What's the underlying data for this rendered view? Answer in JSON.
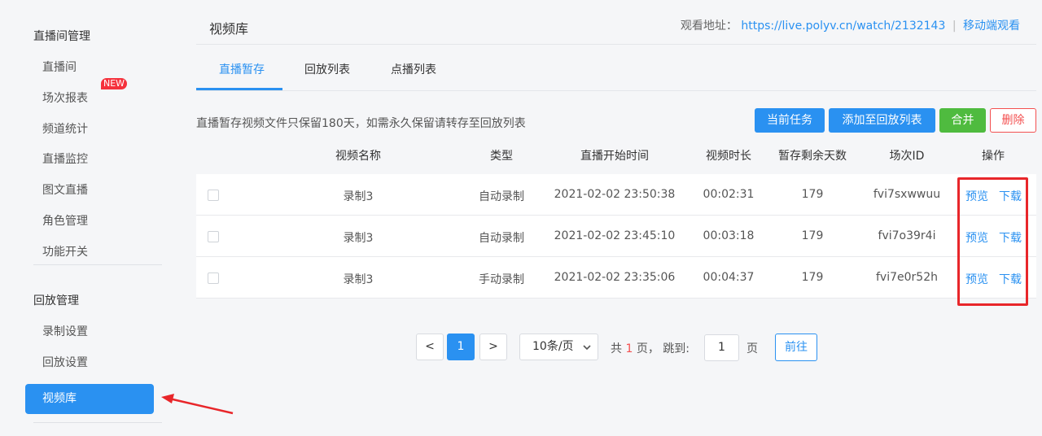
{
  "sidebar": {
    "group1_title": "直播间管理",
    "group1_items": [
      "直播间",
      "场次报表",
      "频道统计",
      "直播监控",
      "图文直播",
      "角色管理",
      "功能开关"
    ],
    "new_badge": "NEW",
    "group2_title": "回放管理",
    "group2_items": [
      "录制设置",
      "回放设置"
    ],
    "active_item": "视频库"
  },
  "header": {
    "title": "视频库",
    "watch_label": "观看地址：",
    "watch_url": "https://live.polyv.cn/watch/2132143",
    "separator": "|",
    "mobile_link": "移动端观看"
  },
  "tabs": [
    "直播暂存",
    "回放列表",
    "点播列表"
  ],
  "notice": "直播暂存视频文件只保留180天，如需永久保留请转存至回放列表",
  "toolbar": {
    "current_task": "当前任务",
    "add_to_playback": "添加至回放列表",
    "merge": "合并",
    "delete": "删除"
  },
  "table": {
    "columns": [
      "视频名称",
      "类型",
      "直播开始时间",
      "视频时长",
      "暂存剩余天数",
      "场次ID",
      "操作"
    ],
    "rows": [
      {
        "name": "录制3",
        "type": "自动录制",
        "start": "2021-02-02 23:50:38",
        "duration": "00:02:31",
        "days": "179",
        "session": "fvi7sxwwuu"
      },
      {
        "name": "录制3",
        "type": "自动录制",
        "start": "2021-02-02 23:45:10",
        "duration": "00:03:18",
        "days": "179",
        "session": "fvi7o39r4i"
      },
      {
        "name": "录制3",
        "type": "手动录制",
        "start": "2021-02-02 23:35:06",
        "duration": "00:04:37",
        "days": "179",
        "session": "fvi7e0r52h"
      }
    ],
    "action_preview": "预览",
    "action_download": "下载"
  },
  "pagination": {
    "prev": "<",
    "current": "1",
    "next": ">",
    "page_size": "10条/页",
    "total_prefix": "共",
    "total_pages": "1",
    "total_suffix": "页，",
    "jump_label": "跳到:",
    "jump_value": "1",
    "page_unit": "页",
    "go": "前往"
  },
  "colors": {
    "accent": "#2a91f1",
    "merge": "#4fbb3f",
    "danger": "#f35050",
    "highlight": "#e8262a"
  }
}
